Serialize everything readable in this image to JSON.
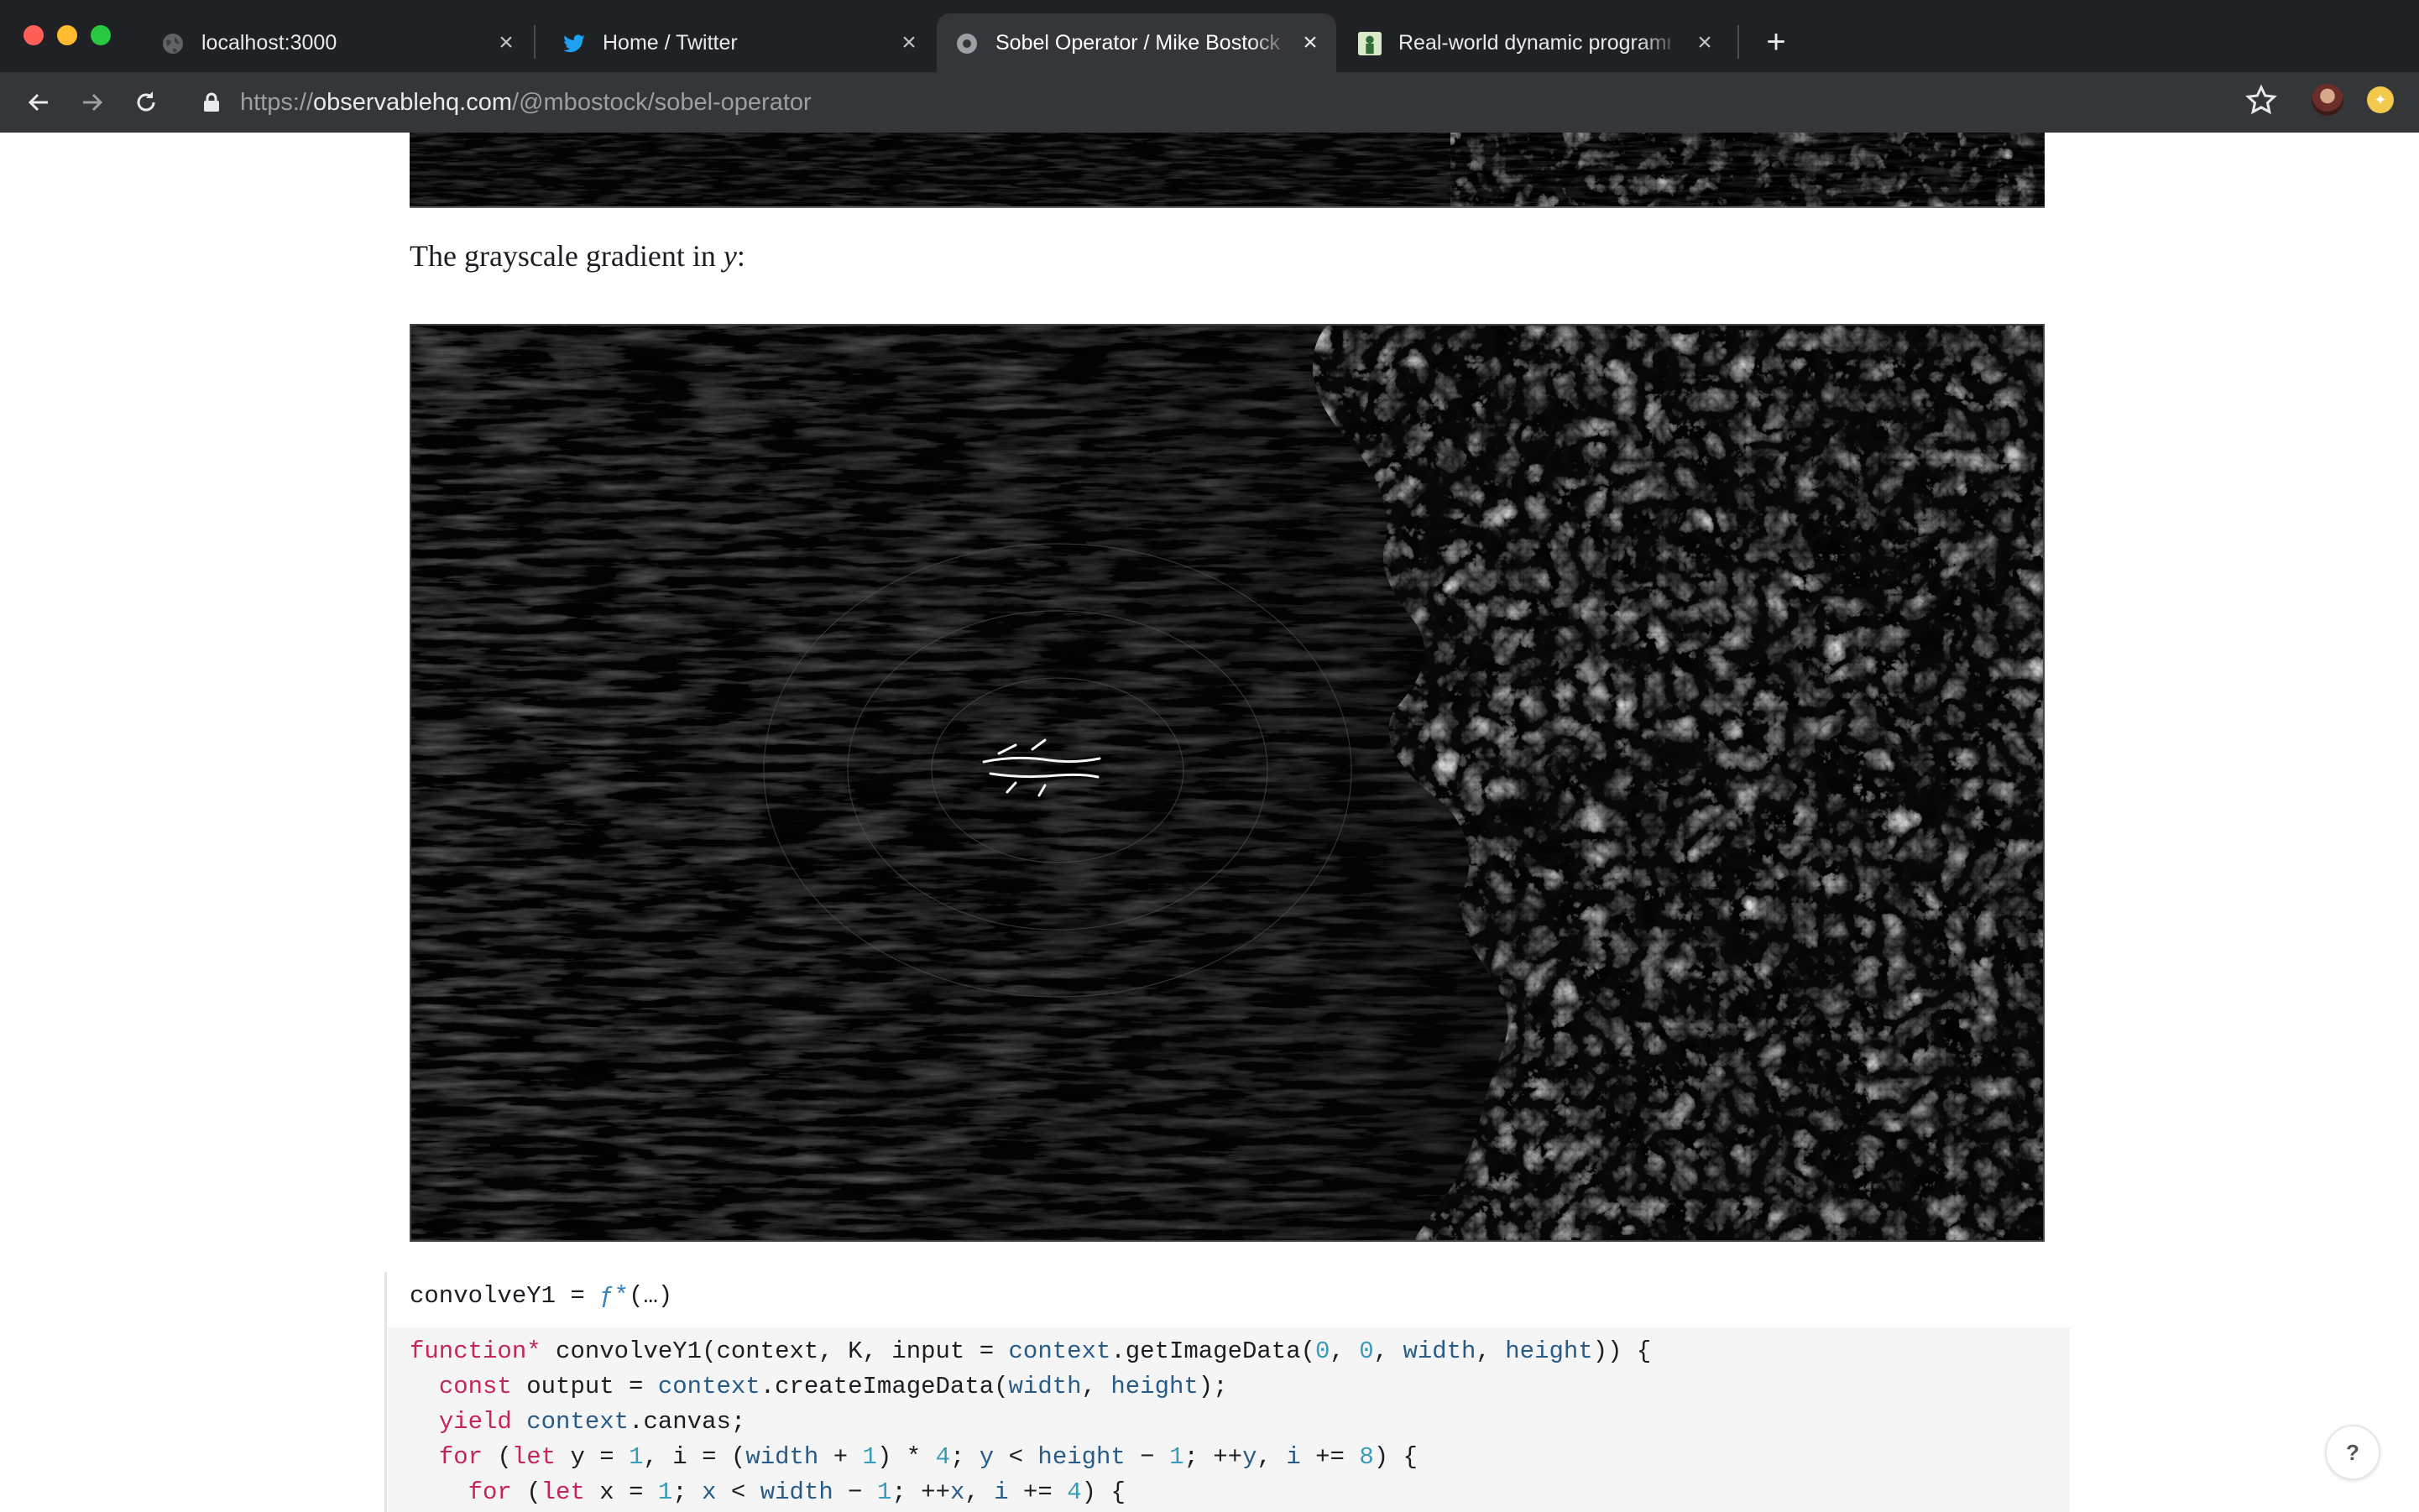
{
  "browser": {
    "tabs": [
      {
        "title": "localhost:3000",
        "favicon": "globe-icon",
        "active": false
      },
      {
        "title": "Home / Twitter",
        "favicon": "twitter-bird-icon",
        "active": false
      },
      {
        "title": "Sobel Operator / Mike Bostock",
        "favicon": "observable-logo-icon",
        "active": true
      },
      {
        "title": "Real-world dynamic programming",
        "favicon": "page-thumbnail-icon",
        "active": false
      }
    ],
    "address": {
      "scheme": "https://",
      "host": "observablehq.com",
      "path": "/@mbostock/sobel-operator"
    }
  },
  "page": {
    "caption_text": "The grayscale gradient in ",
    "caption_var": "y",
    "caption_end": ":",
    "cell": {
      "name": "convolveY1",
      "equals": " = ",
      "value_fn": "ƒ*",
      "value_rest": "(…)"
    },
    "code_lines": [
      [
        [
          "kw",
          "function*"
        ],
        [
          "t",
          " convolveY1(context, K, input = "
        ],
        [
          "id",
          "context"
        ],
        [
          "t",
          ".getImageData("
        ],
        [
          "num",
          "0"
        ],
        [
          "t",
          ", "
        ],
        [
          "num",
          "0"
        ],
        [
          "t",
          ", "
        ],
        [
          "id",
          "width"
        ],
        [
          "t",
          ", "
        ],
        [
          "id",
          "height"
        ],
        [
          "t",
          ")) {"
        ]
      ],
      [
        [
          "t",
          "  "
        ],
        [
          "kw",
          "const"
        ],
        [
          "t",
          " output = "
        ],
        [
          "id",
          "context"
        ],
        [
          "t",
          ".createImageData("
        ],
        [
          "id",
          "width"
        ],
        [
          "t",
          ", "
        ],
        [
          "id",
          "height"
        ],
        [
          "t",
          ");"
        ]
      ],
      [
        [
          "t",
          "  "
        ],
        [
          "kw",
          "yield"
        ],
        [
          "t",
          " "
        ],
        [
          "id",
          "context"
        ],
        [
          "t",
          ".canvas;"
        ]
      ],
      [
        [
          "t",
          "  "
        ],
        [
          "kw",
          "for"
        ],
        [
          "t",
          " ("
        ],
        [
          "kw",
          "let"
        ],
        [
          "t",
          " y = "
        ],
        [
          "num",
          "1"
        ],
        [
          "t",
          ", i = ("
        ],
        [
          "id",
          "width"
        ],
        [
          "t",
          " + "
        ],
        [
          "num",
          "1"
        ],
        [
          "t",
          ") * "
        ],
        [
          "num",
          "4"
        ],
        [
          "t",
          "; "
        ],
        [
          "id",
          "y"
        ],
        [
          "t",
          " < "
        ],
        [
          "id",
          "height"
        ],
        [
          "t",
          " − "
        ],
        [
          "num",
          "1"
        ],
        [
          "t",
          "; ++"
        ],
        [
          "id",
          "y"
        ],
        [
          "t",
          ", "
        ],
        [
          "id",
          "i"
        ],
        [
          "t",
          " += "
        ],
        [
          "num",
          "8"
        ],
        [
          "t",
          ") {"
        ]
      ],
      [
        [
          "t",
          "    "
        ],
        [
          "kw",
          "for"
        ],
        [
          "t",
          " ("
        ],
        [
          "kw",
          "let"
        ],
        [
          "t",
          " x = "
        ],
        [
          "num",
          "1"
        ],
        [
          "t",
          "; "
        ],
        [
          "id",
          "x"
        ],
        [
          "t",
          " < "
        ],
        [
          "id",
          "width"
        ],
        [
          "t",
          " − "
        ],
        [
          "num",
          "1"
        ],
        [
          "t",
          "; ++"
        ],
        [
          "id",
          "x"
        ],
        [
          "t",
          ", "
        ],
        [
          "id",
          "i"
        ],
        [
          "t",
          " += "
        ],
        [
          "num",
          "4"
        ],
        [
          "t",
          ") {"
        ]
      ]
    ],
    "help_label": "?"
  },
  "colors": {
    "keyword": "#c5255d",
    "identifier": "#275b88",
    "number": "#3a9bb8",
    "code_bg": "#f5f5f5",
    "chrome_dark": "#202124",
    "chrome_toolbar": "#35363a"
  }
}
